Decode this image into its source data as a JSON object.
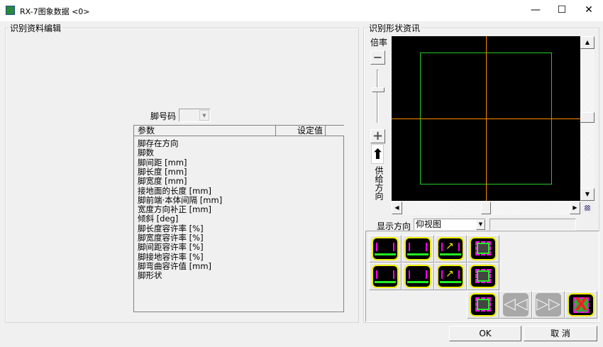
{
  "window": {
    "title": "RX-7图象数据 <0>",
    "minimize": "—",
    "maximize": "☐",
    "close": "✕"
  },
  "left_group": {
    "title": "识别资料编辑",
    "pin_code_label": "脚号码",
    "pin_code_value": "",
    "table": {
      "headers": [
        "参数",
        "设定值"
      ],
      "rows": [
        "脚存在方向",
        "脚数",
        "脚间距 [mm]",
        "脚长度 [mm]",
        "脚宽度 [mm]",
        "接地面的长度 [mm]",
        "脚前端·本体间隔 [mm]",
        "宽度方向补正 [mm]",
        "倾斜 [deg]",
        "脚长度容许率 [%]",
        "脚宽度容许率 [%]",
        "脚间距容许率 [%]",
        "脚接地容许率 [%]",
        "脚弯曲容许值 [mm]",
        "脚形状"
      ]
    }
  },
  "right_group": {
    "title": "识别形状资讯",
    "zoom_label": "倍率",
    "zoom_level": 0.35,
    "feed_direction_label": "供给方向",
    "display_direction_label": "显示方向",
    "display_direction_value": "仰视图",
    "info_value": "",
    "colors": {
      "canvas": "#000000",
      "outline": "#22cc22",
      "crosshair": "#ff8c00"
    },
    "icon_buttons": [
      "lead-check",
      "lead-delete",
      "rotate",
      "qfp-4side",
      "lead-add",
      "lead-flip",
      "lead-shift",
      "qfp-2side",
      "qfp-square",
      "prev",
      "next",
      "clear-all"
    ]
  },
  "footer": {
    "ok": "OK",
    "cancel": "取 消"
  }
}
